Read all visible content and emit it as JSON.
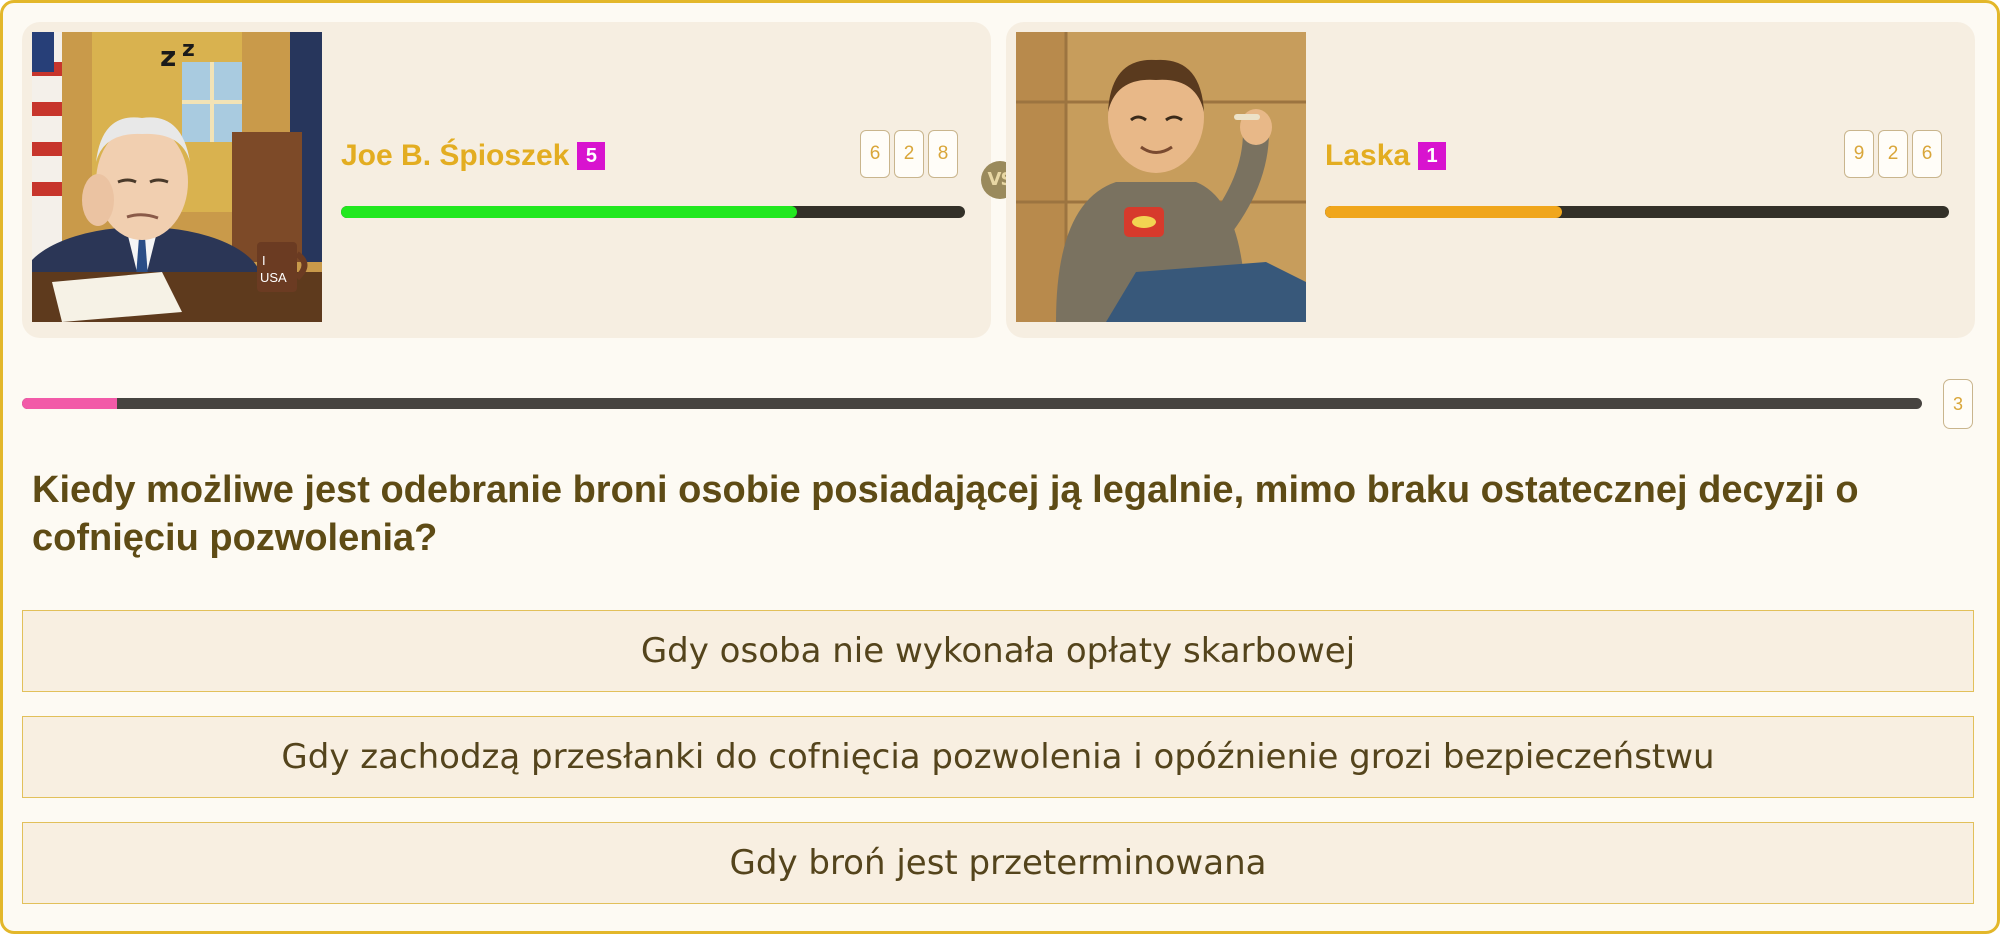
{
  "players": [
    {
      "name": "Joe B. Śpioszek",
      "level": "5",
      "stats": [
        "6",
        "2",
        "8"
      ],
      "health": 0.73,
      "health_color": "#22e81f",
      "avatar_icon": "sleepy-president-at-desk",
      "mug_text_1": "I",
      "mug_text_2": "USA"
    },
    {
      "name": "Laska",
      "level": "1",
      "stats": [
        "9",
        "2",
        "6"
      ],
      "health": 0.38,
      "health_color": "#f0a61c",
      "avatar_icon": "relaxed-man-smoking"
    }
  ],
  "vs_label": "VS",
  "timer": {
    "progress": 0.05,
    "color": "#f25aa8"
  },
  "round": "3",
  "question": "Kiedy możliwe jest odebranie broni osobie posiadającej ją legalnie, mimo braku ostatecznej decyzji o cofnięciu pozwolenia?",
  "answers": [
    "Gdy osoba nie wykonała opłaty skarbowej",
    "Gdy zachodzą przesłanki do cofnięcia pozwolenia i opóźnienie grozi bezpieczeństwu",
    "Gdy broń jest przeterminowana"
  ],
  "colors": {
    "accent": "#e3ad21",
    "frame": "#e3b72a",
    "level_badge": "#d813cf"
  }
}
